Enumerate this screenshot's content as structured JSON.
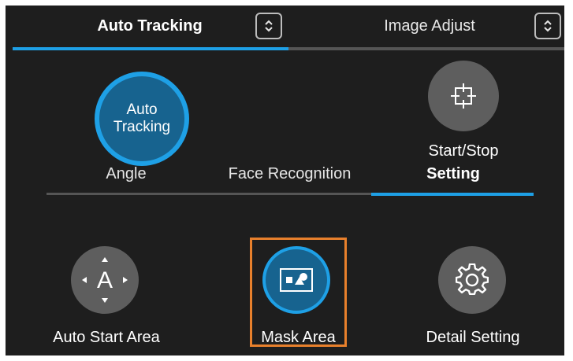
{
  "top_tabs": [
    {
      "label": "Auto Tracking",
      "active": true
    },
    {
      "label": "Image Adjust",
      "active": false
    }
  ],
  "top_stepper_icon": "up-down-chevron-icon",
  "auto_tracking_button": {
    "line1": "Auto",
    "line2": "Tracking"
  },
  "start_stop": {
    "label": "Start/Stop",
    "icon": "crosshair-icon"
  },
  "sub_tabs": [
    {
      "label": "Angle",
      "active": false
    },
    {
      "label": "Face Recognition",
      "active": false
    },
    {
      "label": "Setting",
      "active": true
    }
  ],
  "settings": [
    {
      "label": "Auto Start Area",
      "icon": "auto-start-area-icon"
    },
    {
      "label": "Mask Area",
      "icon": "mask-area-icon",
      "highlighted": true
    },
    {
      "label": "Detail Setting",
      "icon": "gear-icon"
    }
  ],
  "colors": {
    "accent": "#1ea0e6",
    "background": "#1e1e1e",
    "button_grey": "#5e5e5e",
    "highlight": "#e8802c"
  }
}
